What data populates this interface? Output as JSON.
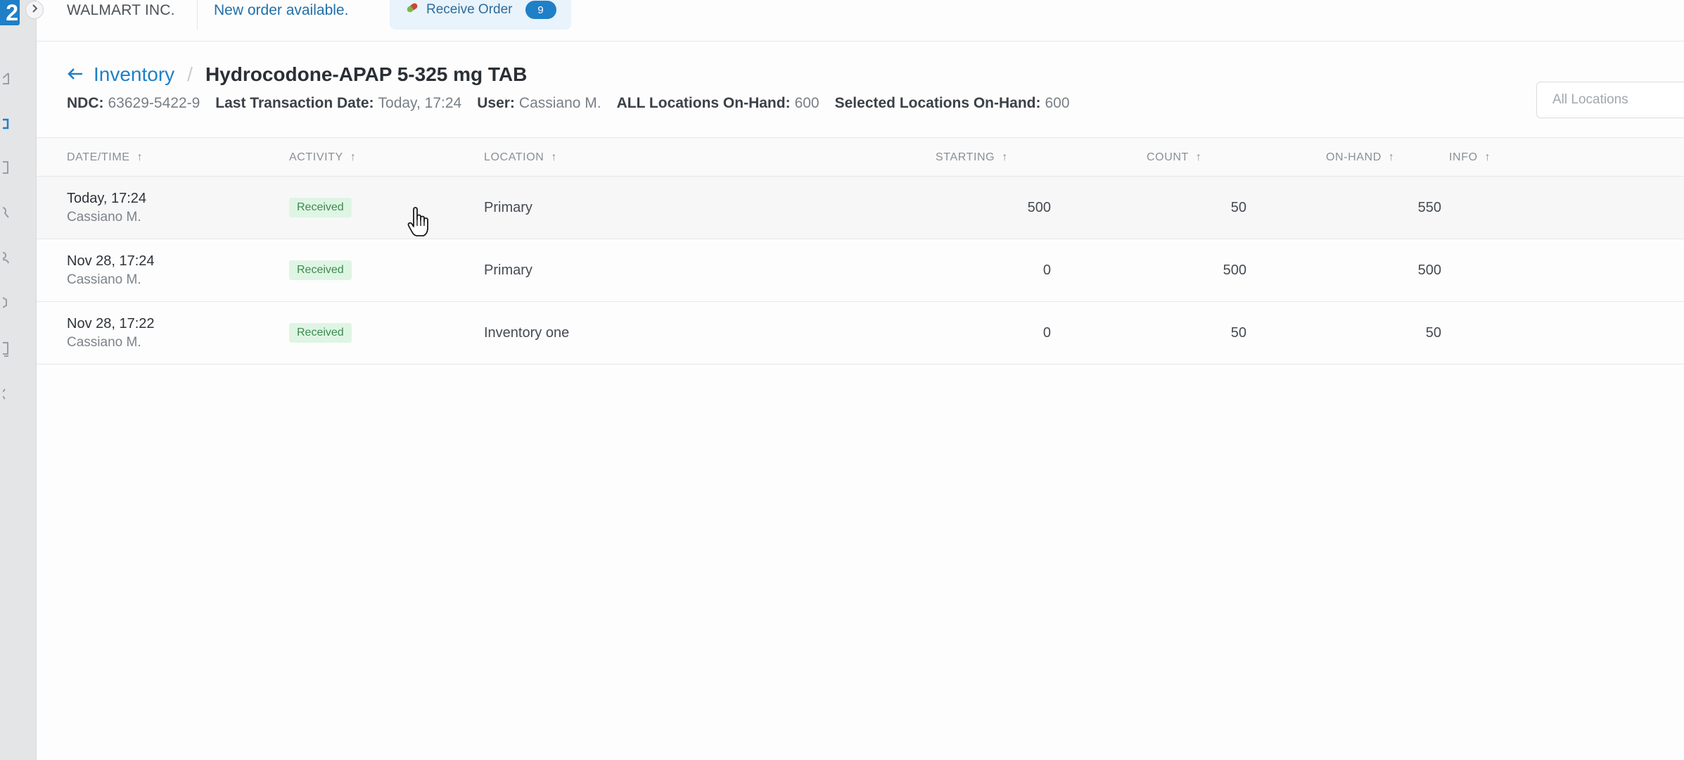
{
  "sidebar": {
    "logo_text": "2",
    "nav_icons": [
      "home-icon",
      "inventory-icon",
      "document-icon",
      "search-icon",
      "user-icon",
      "settings-icon",
      "device-icon",
      "sync-icon"
    ]
  },
  "topbar": {
    "company": "WALMART INC.",
    "notification": "New order available.",
    "receive_order_label": "Receive Order",
    "receive_order_count": "9"
  },
  "header": {
    "back_label": "Inventory",
    "title": "Hydrocodone-APAP 5-325 mg TAB",
    "meta": {
      "ndc_label": "NDC:",
      "ndc_value": "63629-5422-9",
      "last_tx_label": "Last Transaction Date:",
      "last_tx_value": "Today, 17:24",
      "user_label": "User:",
      "user_value": "Cassiano M.",
      "all_loc_label": "ALL Locations On-Hand:",
      "all_loc_value": "600",
      "sel_loc_label": "Selected Locations On-Hand:",
      "sel_loc_value": "600"
    },
    "location_select_placeholder": "All Locations"
  },
  "table": {
    "columns": {
      "datetime": "DATE/TIME",
      "activity": "ACTIVITY",
      "location": "LOCATION",
      "starting": "STARTING",
      "count": "COUNT",
      "onhand": "ON-HAND",
      "info": "INFO"
    },
    "sort_arrow": "↑",
    "rows": [
      {
        "date": "Today, 17:24",
        "user": "Cassiano M.",
        "activity": "Received",
        "location": "Primary",
        "starting": "500",
        "count": "50",
        "onhand": "550"
      },
      {
        "date": "Nov 28, 17:24",
        "user": "Cassiano M.",
        "activity": "Received",
        "location": "Primary",
        "starting": "0",
        "count": "500",
        "onhand": "500"
      },
      {
        "date": "Nov 28, 17:22",
        "user": "Cassiano M.",
        "activity": "Received",
        "location": "Inventory one",
        "starting": "0",
        "count": "50",
        "onhand": "50"
      }
    ]
  },
  "colors": {
    "accent": "#1f7fc7",
    "badge_bg": "#dff5e4",
    "badge_text": "#3c8a4f"
  }
}
